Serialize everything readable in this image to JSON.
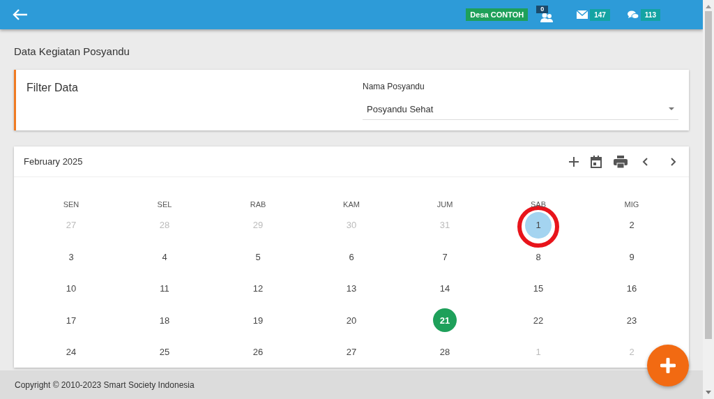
{
  "top_bar": {
    "village_badge": "Desa CONTOH",
    "notifications": [
      {
        "kind": "users",
        "count": "0"
      },
      {
        "kind": "mail",
        "count": "147"
      },
      {
        "kind": "chat",
        "count": "113"
      }
    ]
  },
  "page_title": "Data Kegiatan Posyandu",
  "filter": {
    "title": "Filter Data",
    "field_label": "Nama Posyandu",
    "value": "Posyandu Sehat"
  },
  "calendar": {
    "month": "February 2025",
    "weekdays": [
      "SEN",
      "SEL",
      "RAB",
      "KAM",
      "JUM",
      "SAB",
      "MIG"
    ],
    "weeks": [
      [
        {
          "day": "27",
          "outside": true,
          "selected": false,
          "event": false,
          "circled": false
        },
        {
          "day": "28",
          "outside": true,
          "selected": false,
          "event": false,
          "circled": false
        },
        {
          "day": "29",
          "outside": true,
          "selected": false,
          "event": false,
          "circled": false
        },
        {
          "day": "30",
          "outside": true,
          "selected": false,
          "event": false,
          "circled": false
        },
        {
          "day": "31",
          "outside": true,
          "selected": false,
          "event": false,
          "circled": false
        },
        {
          "day": "1",
          "outside": false,
          "selected": true,
          "event": false,
          "circled": true
        },
        {
          "day": "2",
          "outside": false,
          "selected": false,
          "event": false,
          "circled": false
        }
      ],
      [
        {
          "day": "3",
          "outside": false,
          "selected": false,
          "event": false,
          "circled": false
        },
        {
          "day": "4",
          "outside": false,
          "selected": false,
          "event": false,
          "circled": false
        },
        {
          "day": "5",
          "outside": false,
          "selected": false,
          "event": false,
          "circled": false
        },
        {
          "day": "6",
          "outside": false,
          "selected": false,
          "event": false,
          "circled": false
        },
        {
          "day": "7",
          "outside": false,
          "selected": false,
          "event": false,
          "circled": false
        },
        {
          "day": "8",
          "outside": false,
          "selected": false,
          "event": false,
          "circled": false
        },
        {
          "day": "9",
          "outside": false,
          "selected": false,
          "event": false,
          "circled": false
        }
      ],
      [
        {
          "day": "10",
          "outside": false,
          "selected": false,
          "event": false,
          "circled": false
        },
        {
          "day": "11",
          "outside": false,
          "selected": false,
          "event": false,
          "circled": false
        },
        {
          "day": "12",
          "outside": false,
          "selected": false,
          "event": false,
          "circled": false
        },
        {
          "day": "13",
          "outside": false,
          "selected": false,
          "event": false,
          "circled": false
        },
        {
          "day": "14",
          "outside": false,
          "selected": false,
          "event": false,
          "circled": false
        },
        {
          "day": "15",
          "outside": false,
          "selected": false,
          "event": false,
          "circled": false
        },
        {
          "day": "16",
          "outside": false,
          "selected": false,
          "event": false,
          "circled": false
        }
      ],
      [
        {
          "day": "17",
          "outside": false,
          "selected": false,
          "event": false,
          "circled": false
        },
        {
          "day": "18",
          "outside": false,
          "selected": false,
          "event": false,
          "circled": false
        },
        {
          "day": "19",
          "outside": false,
          "selected": false,
          "event": false,
          "circled": false
        },
        {
          "day": "20",
          "outside": false,
          "selected": false,
          "event": false,
          "circled": false
        },
        {
          "day": "21",
          "outside": false,
          "selected": false,
          "event": true,
          "circled": false
        },
        {
          "day": "22",
          "outside": false,
          "selected": false,
          "event": false,
          "circled": false
        },
        {
          "day": "23",
          "outside": false,
          "selected": false,
          "event": false,
          "circled": false
        }
      ],
      [
        {
          "day": "24",
          "outside": false,
          "selected": false,
          "event": false,
          "circled": false
        },
        {
          "day": "25",
          "outside": false,
          "selected": false,
          "event": false,
          "circled": false
        },
        {
          "day": "26",
          "outside": false,
          "selected": false,
          "event": false,
          "circled": false
        },
        {
          "day": "27",
          "outside": false,
          "selected": false,
          "event": false,
          "circled": false
        },
        {
          "day": "28",
          "outside": false,
          "selected": false,
          "event": false,
          "circled": false
        },
        {
          "day": "1",
          "outside": true,
          "selected": false,
          "event": false,
          "circled": false
        },
        {
          "day": "2",
          "outside": true,
          "selected": false,
          "event": false,
          "circled": false
        }
      ]
    ]
  },
  "footer": "Copyright © 2010-2023 Smart Society Indonesia"
}
